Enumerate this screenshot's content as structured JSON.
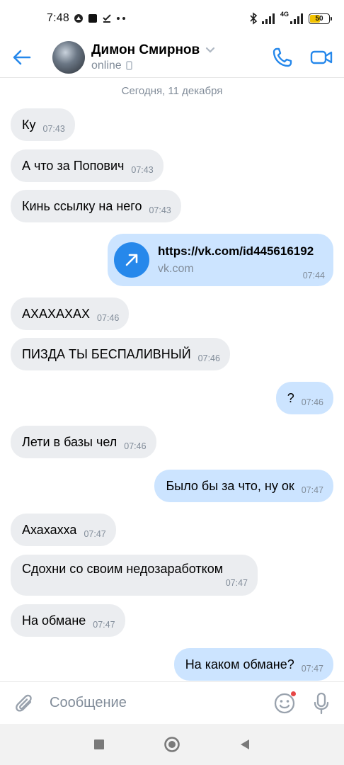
{
  "status_bar": {
    "time": "7:48",
    "network": "4G",
    "battery": "50"
  },
  "header": {
    "contact_name": "Димон Смирнов",
    "status": "online"
  },
  "chat": {
    "date_separator": "Сегодня, 11 декабря",
    "messages": [
      {
        "text": "Ку",
        "time": "07:43"
      },
      {
        "text": "А что за Попович",
        "time": "07:43"
      },
      {
        "text": "Кинь ссылку на него",
        "time": "07:43"
      },
      {
        "link_url": "https://vk.com/id445616192",
        "link_domain": "vk.com",
        "time": "07:44"
      },
      {
        "text": "АХАХАХАХ",
        "time": "07:46"
      },
      {
        "text": "ПИЗДА ТЫ БЕСПАЛИВНЫЙ",
        "time": "07:46"
      },
      {
        "text": "?",
        "time": "07:46"
      },
      {
        "text": "Лети в базы чел",
        "time": "07:46"
      },
      {
        "text": "Было бы за что, ну ок",
        "time": "07:47"
      },
      {
        "text": "Ахахахха",
        "time": "07:47"
      },
      {
        "text": "Сдохни со своим недозаработком",
        "time": "07:47"
      },
      {
        "text": "На обмане",
        "time": "07:47"
      },
      {
        "text": "На каком обмане?",
        "time": "07:47"
      }
    ]
  },
  "composer": {
    "placeholder": "Сообщение"
  },
  "colors": {
    "accent": "#2688eb",
    "incoming_bubble": "#ebedf0",
    "outgoing_bubble": "#cce4ff",
    "secondary_text": "#818c99"
  },
  "icons": [
    "back-arrow-icon",
    "chevron-down-icon",
    "phone-icon",
    "video-call-icon",
    "attach-icon",
    "emoji-icon",
    "microphone-icon",
    "link-arrow-icon"
  ]
}
